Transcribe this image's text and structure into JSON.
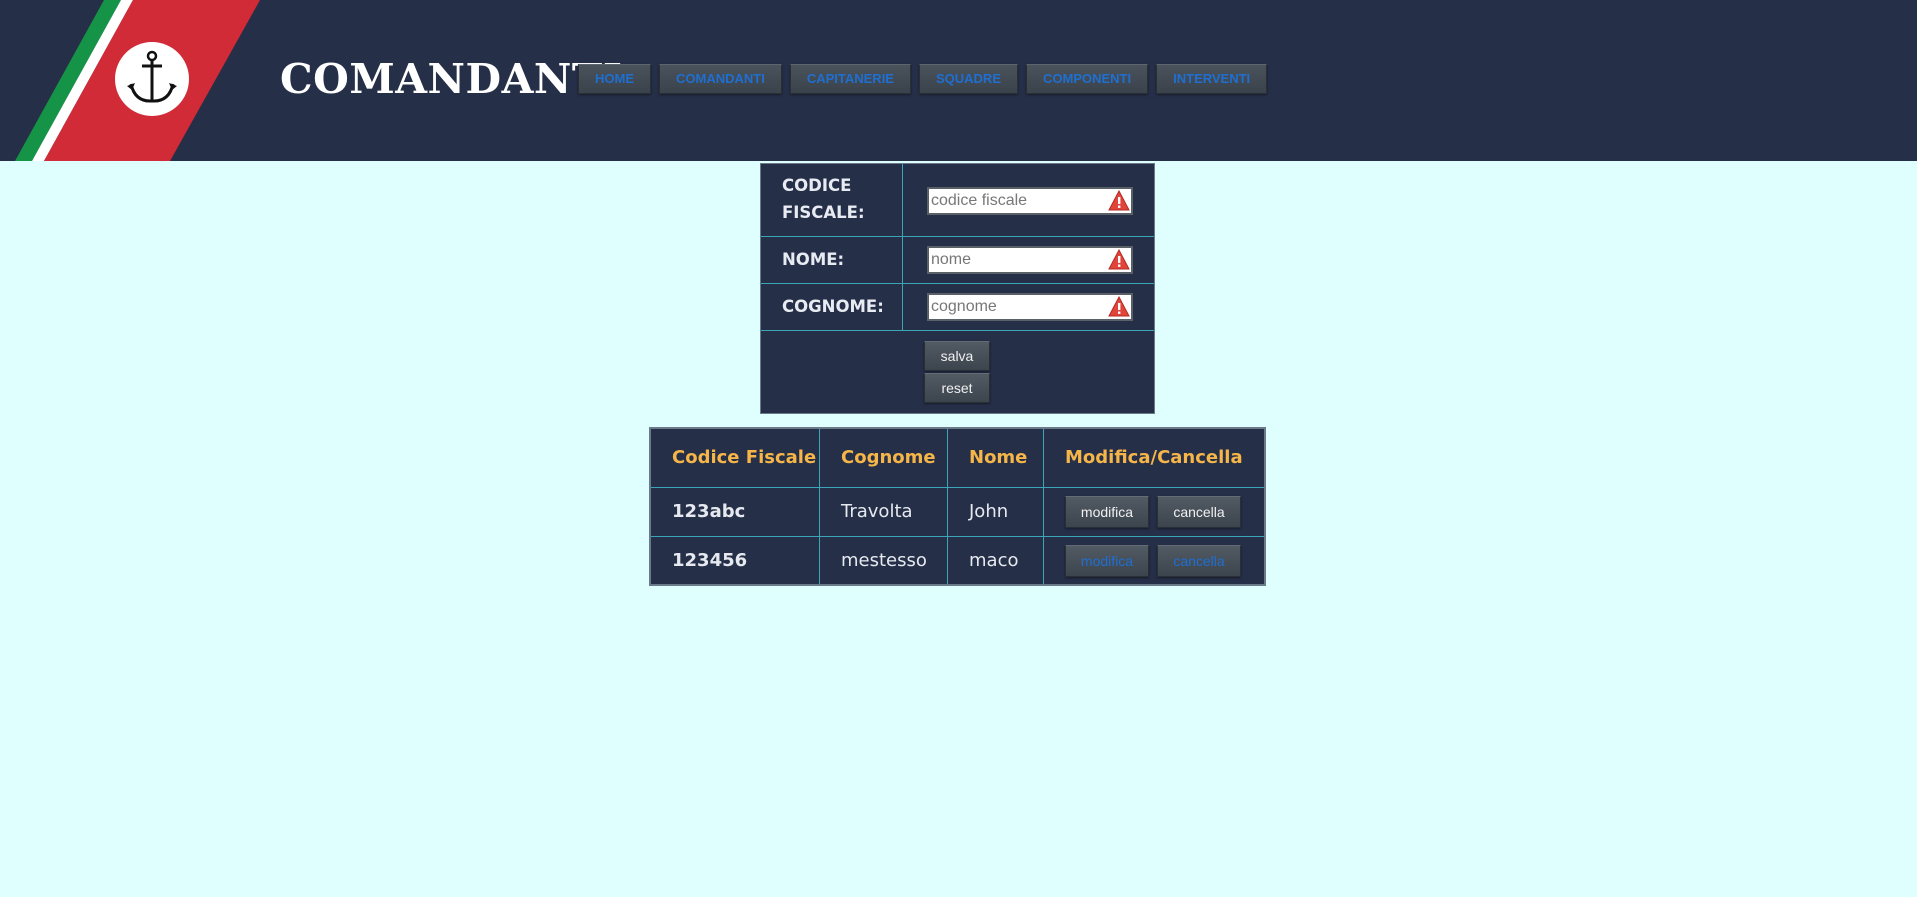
{
  "header": {
    "title": "COMANDANTI",
    "nav": [
      "HOME",
      "COMANDANTI",
      "CAPITANERIE",
      "SQUADRE",
      "COMPONENTI",
      "INTERVENTI"
    ],
    "logo_icon": "anchor-icon",
    "colors": {
      "background": "#252f48",
      "nav_text": "#1f6fd1",
      "stripe_green": "#159447",
      "stripe_red": "#d12b37"
    }
  },
  "form": {
    "fields": [
      {
        "label_line1": "CODICE",
        "label_line2": "FISCALE:",
        "placeholder": "codice fiscale",
        "value": ""
      },
      {
        "label": "NOME:",
        "placeholder": "nome",
        "value": ""
      },
      {
        "label": "COGNOME:",
        "placeholder": "cognome",
        "value": ""
      }
    ],
    "buttons": {
      "save": "salva",
      "reset": "reset"
    },
    "warning_icon": "warning-icon"
  },
  "table": {
    "headers": [
      "Codice Fiscale",
      "Cognome",
      "Nome",
      "Modifica/Cancella"
    ],
    "rows": [
      {
        "codice": "123abc",
        "cognome": "Travolta",
        "nome": "John",
        "edit": "modifica",
        "delete": "cancella"
      },
      {
        "codice": "123456",
        "cognome": "mestesso",
        "nome": "maco",
        "edit": "modifica",
        "delete": "cancella"
      }
    ],
    "colors": {
      "header_text": "#f5b548",
      "border": "#3aa6b8"
    }
  },
  "page": {
    "background": "#dfffff"
  }
}
